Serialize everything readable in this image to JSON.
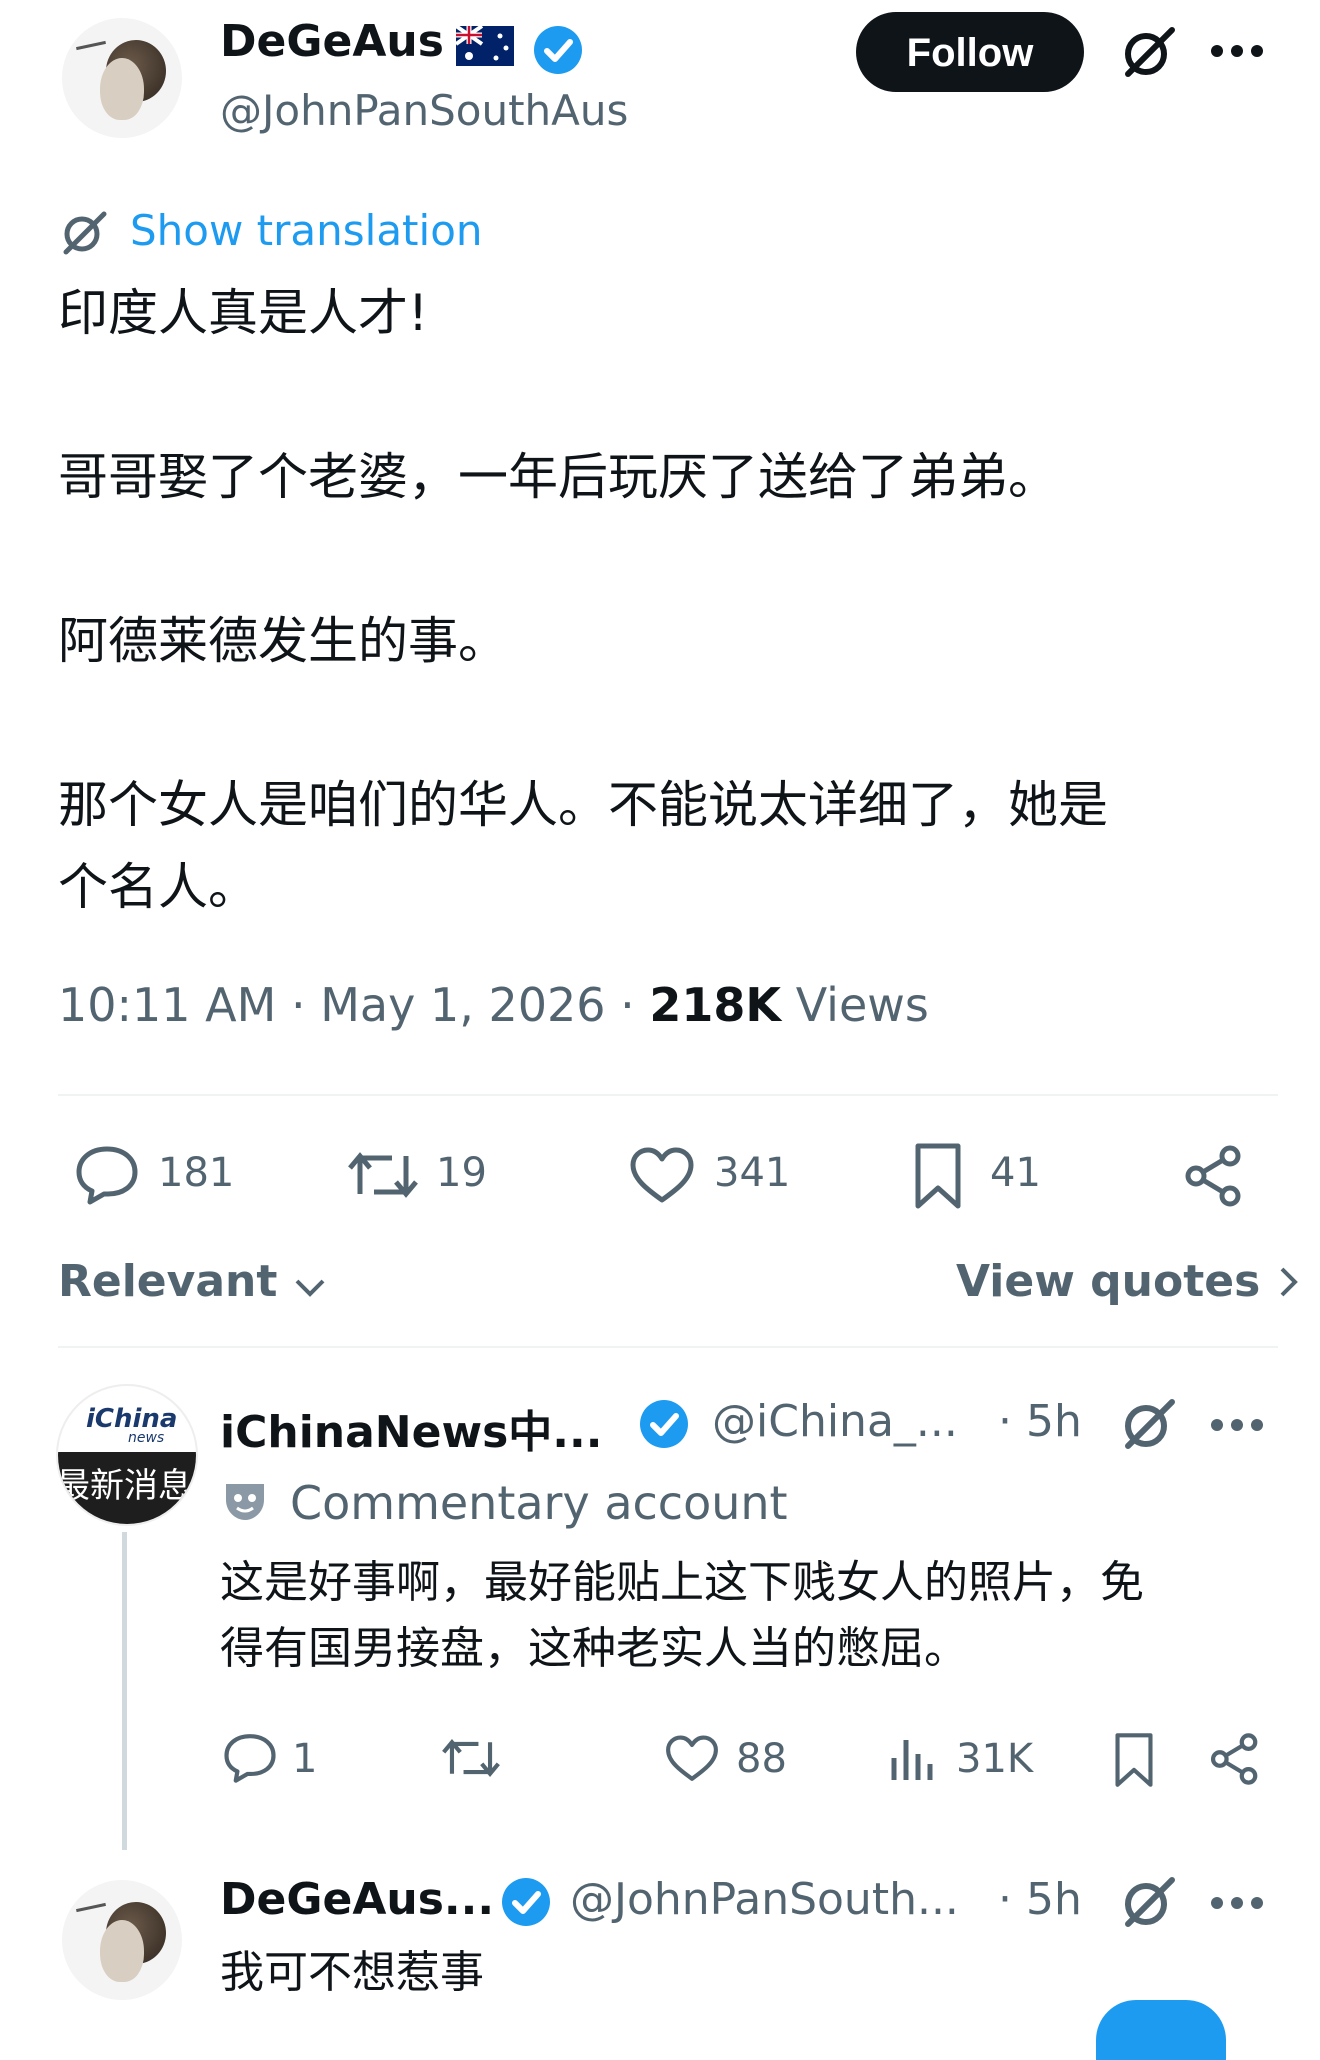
{
  "post": {
    "author": {
      "name": "DeGeAus",
      "flag": "australia-flag",
      "verified": true,
      "handle": "@JohnPanSouthAus"
    },
    "follow_label": "Follow",
    "translation_label": "Show translation",
    "text": "印度人真是人才!\n\n哥哥娶了个老婆，一年后玩厌了送给了弟弟。\n\n阿德莱德发生的事。\n\n那个女人是咱们的华人。不能说太详细了，她是\n个名人。",
    "time": "10:11 AM",
    "date": "May 1, 2026",
    "views_count": "218K",
    "views_label": "Views",
    "stats": {
      "replies": "181",
      "reposts": "19",
      "likes": "341",
      "bookmarks": "41"
    }
  },
  "sort": {
    "label": "Relevant",
    "view_quotes": "View quotes"
  },
  "replies": [
    {
      "name": "iChinaNews中...",
      "handle": "@iChina_...",
      "time": "· 5h",
      "avatar_text_top": "iChina",
      "avatar_text_small": "news",
      "avatar_text_bottom": "最新消息",
      "commentary_label": "Commentary account",
      "text": "这是好事啊，最好能贴上这下贱女人的照片，免\n得有国男接盘，这种老实人当的憋屈。",
      "stats": {
        "replies": "1",
        "likes": "88",
        "views": "31K"
      }
    },
    {
      "name": "DeGeAus...",
      "handle": "@JohnPanSouth...",
      "time": "· 5h",
      "text": "我可不想惹事"
    }
  ],
  "colors": {
    "accent": "#1d9bf0",
    "text": "#0f1419",
    "secondary": "#536471"
  }
}
